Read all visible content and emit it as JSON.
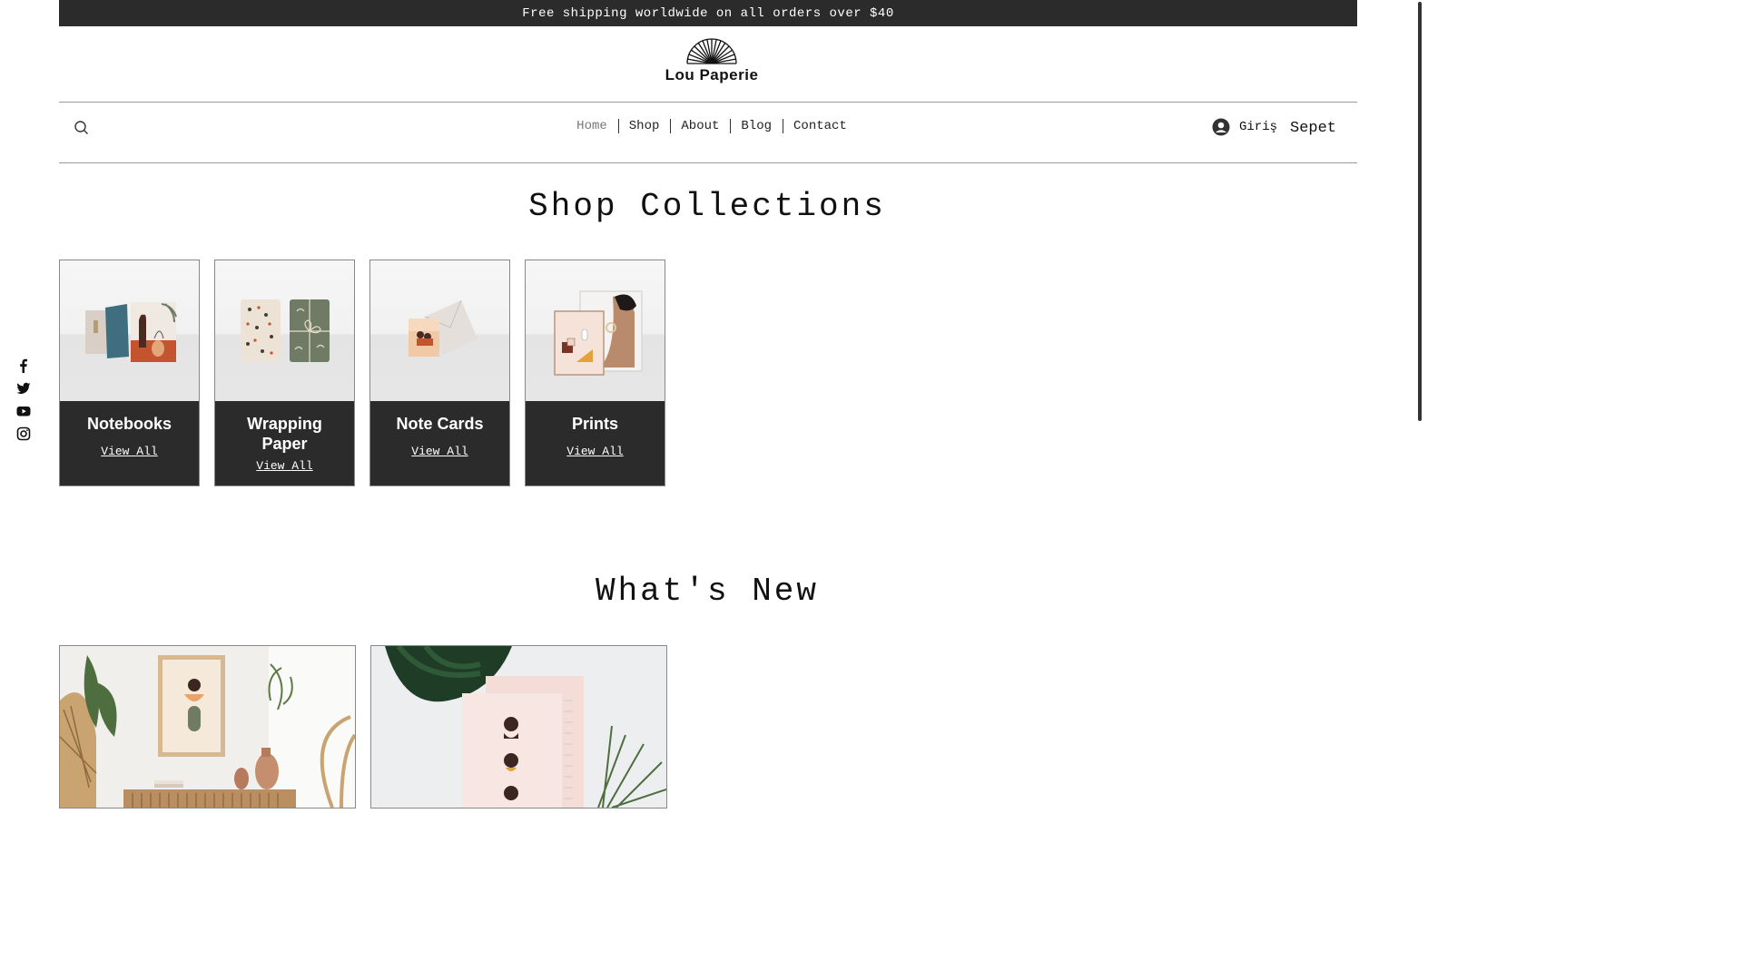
{
  "announcement": "Free shipping worldwide on all orders over $40",
  "brand": {
    "name": "Lou Paperie",
    "logo_icon": "fan-logo-icon"
  },
  "nav": {
    "search_icon": "search-icon",
    "items": [
      {
        "label": "Home",
        "active": true
      },
      {
        "label": "Shop",
        "active": false
      },
      {
        "label": "About",
        "active": false
      },
      {
        "label": "Blog",
        "active": false
      },
      {
        "label": "Contact",
        "active": false
      }
    ],
    "login_label": "Giriş",
    "login_icon": "user-avatar-icon",
    "cart_label": "Sepet"
  },
  "collections": {
    "heading": "Shop Collections",
    "items": [
      {
        "title": "Notebooks",
        "link": "View All"
      },
      {
        "title": "Wrapping Paper",
        "link": "View All"
      },
      {
        "title": "Note Cards",
        "link": "View All"
      },
      {
        "title": "Prints",
        "link": "View All"
      }
    ]
  },
  "whats_new": {
    "heading": "What's New"
  },
  "social": [
    "facebook-icon",
    "twitter-icon",
    "youtube-icon",
    "instagram-icon"
  ],
  "colors": {
    "dark": "#2b2b2b",
    "accent_terracotta": "#c4542d",
    "teal": "#3f6f7e",
    "sage": "#6f7b64"
  }
}
